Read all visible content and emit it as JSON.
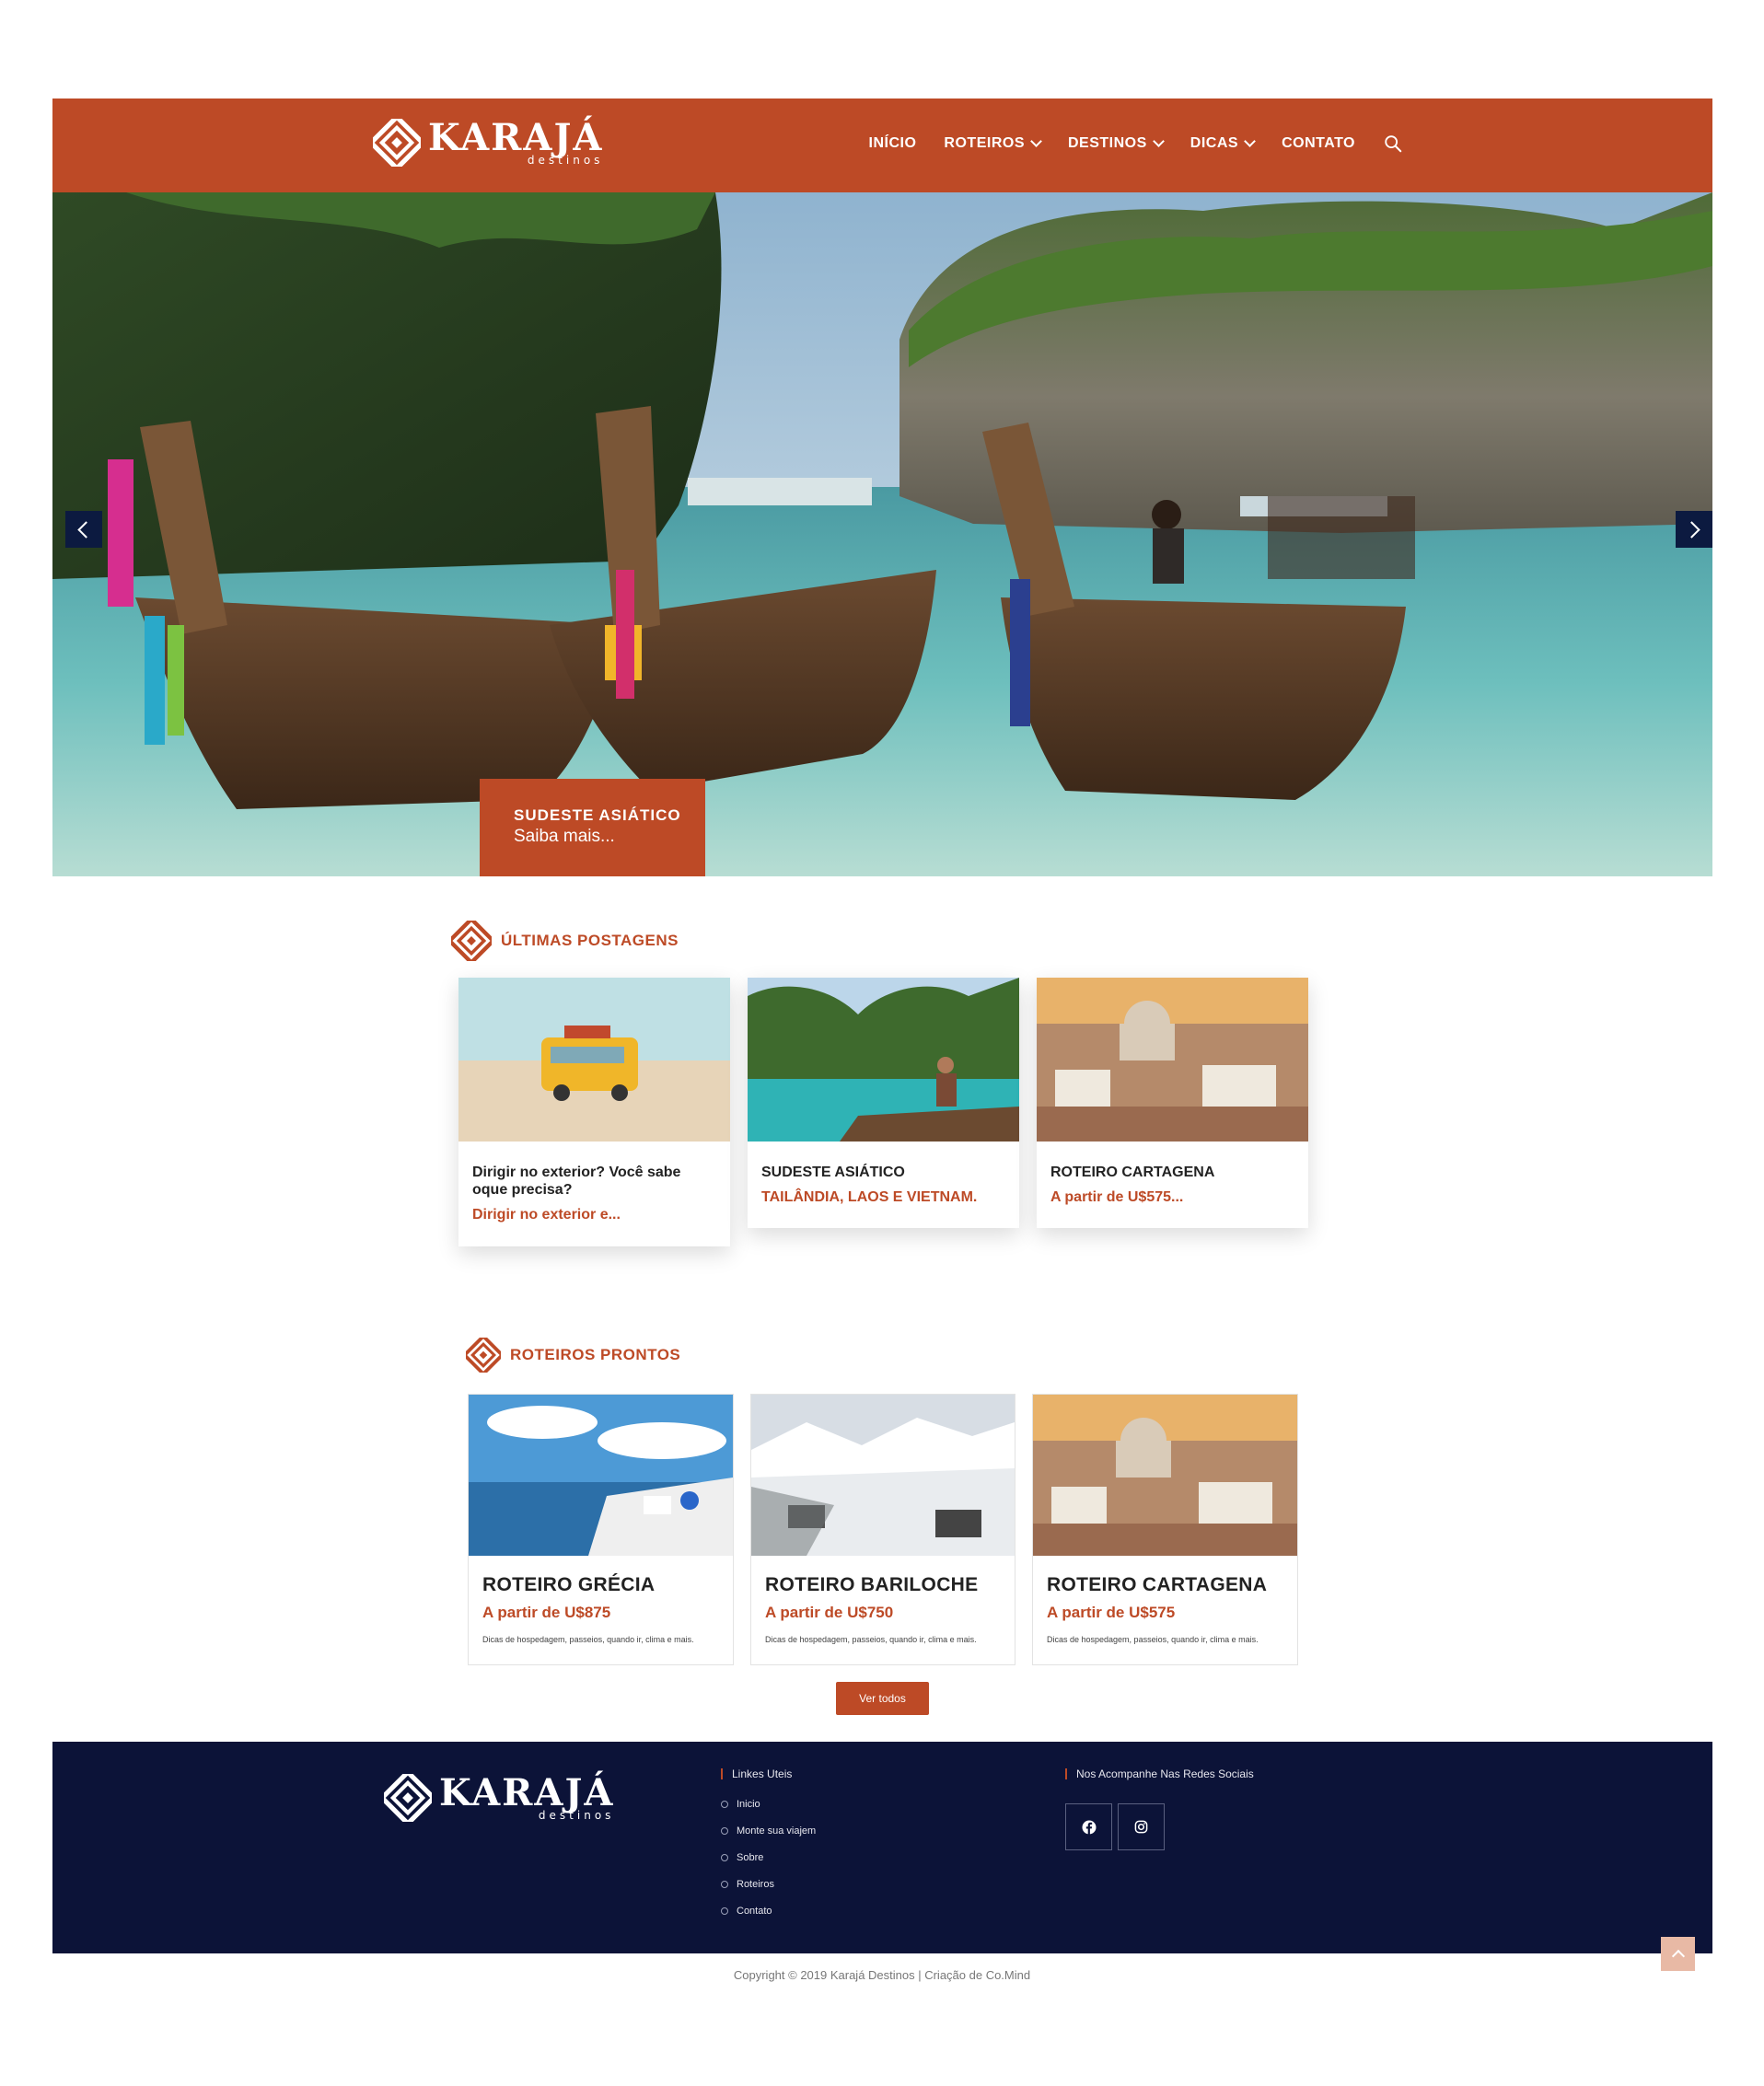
{
  "brand": {
    "name": "KARAJÁ",
    "tagline": "destinos"
  },
  "nav": {
    "items": [
      {
        "label": "INÍCIO",
        "dropdown": false
      },
      {
        "label": "ROTEIROS",
        "dropdown": true
      },
      {
        "label": "DESTINOS",
        "dropdown": true
      },
      {
        "label": "DICAS",
        "dropdown": true
      },
      {
        "label": "CONTATO",
        "dropdown": false
      }
    ],
    "search_icon": "search-icon"
  },
  "hero": {
    "cta_title": "SUDESTE ASIÁTICO",
    "cta_subtitle": "Saiba mais...",
    "prev_icon": "chevron-left-icon",
    "next_icon": "chevron-right-icon"
  },
  "latest_posts": {
    "heading": "ÚLTIMAS POSTAGENS",
    "posts": [
      {
        "title": "Dirigir no exterior? Você sabe oque precisa?",
        "subtitle": "Dirigir no exterior e..."
      },
      {
        "title": "SUDESTE ASIÁTICO",
        "subtitle": "TAILÂNDIA, LAOS E VIETNAM."
      },
      {
        "title": "ROTEIRO CARTAGENA",
        "subtitle": "A partir de U$575..."
      }
    ]
  },
  "itineraries": {
    "heading": "ROTEIROS PRONTOS",
    "items": [
      {
        "title": "ROTEIRO GRÉCIA",
        "price": "A partir de U$875",
        "desc": "Dicas de hospedagem, passeios, quando ir, clima e mais."
      },
      {
        "title": "ROTEIRO BARILOCHE",
        "price": "A partir de U$750",
        "desc": "Dicas de hospedagem, passeios, quando ir, clima e mais."
      },
      {
        "title": "ROTEIRO CARTAGENA",
        "price": "A partir de U$575",
        "desc": "Dicas de hospedagem, passeios, quando ir, clima e mais."
      }
    ],
    "button_label": "Ver todos"
  },
  "footer": {
    "links_heading": "Linkes Uteis",
    "links": [
      "Inicio",
      "Monte sua viajem",
      "Sobre",
      "Roteiros",
      "Contato"
    ],
    "social_heading": "Nos Acompanhe Nas Redes Sociais",
    "social": [
      "facebook-icon",
      "instagram-icon"
    ],
    "copyright": "Copyright © 2019 Karajá Destinos | Criação de Co.Mind"
  },
  "colors": {
    "accent": "#bd4a26",
    "footer_bg": "#0c1338",
    "nav_arrow": "#0c1a40"
  }
}
